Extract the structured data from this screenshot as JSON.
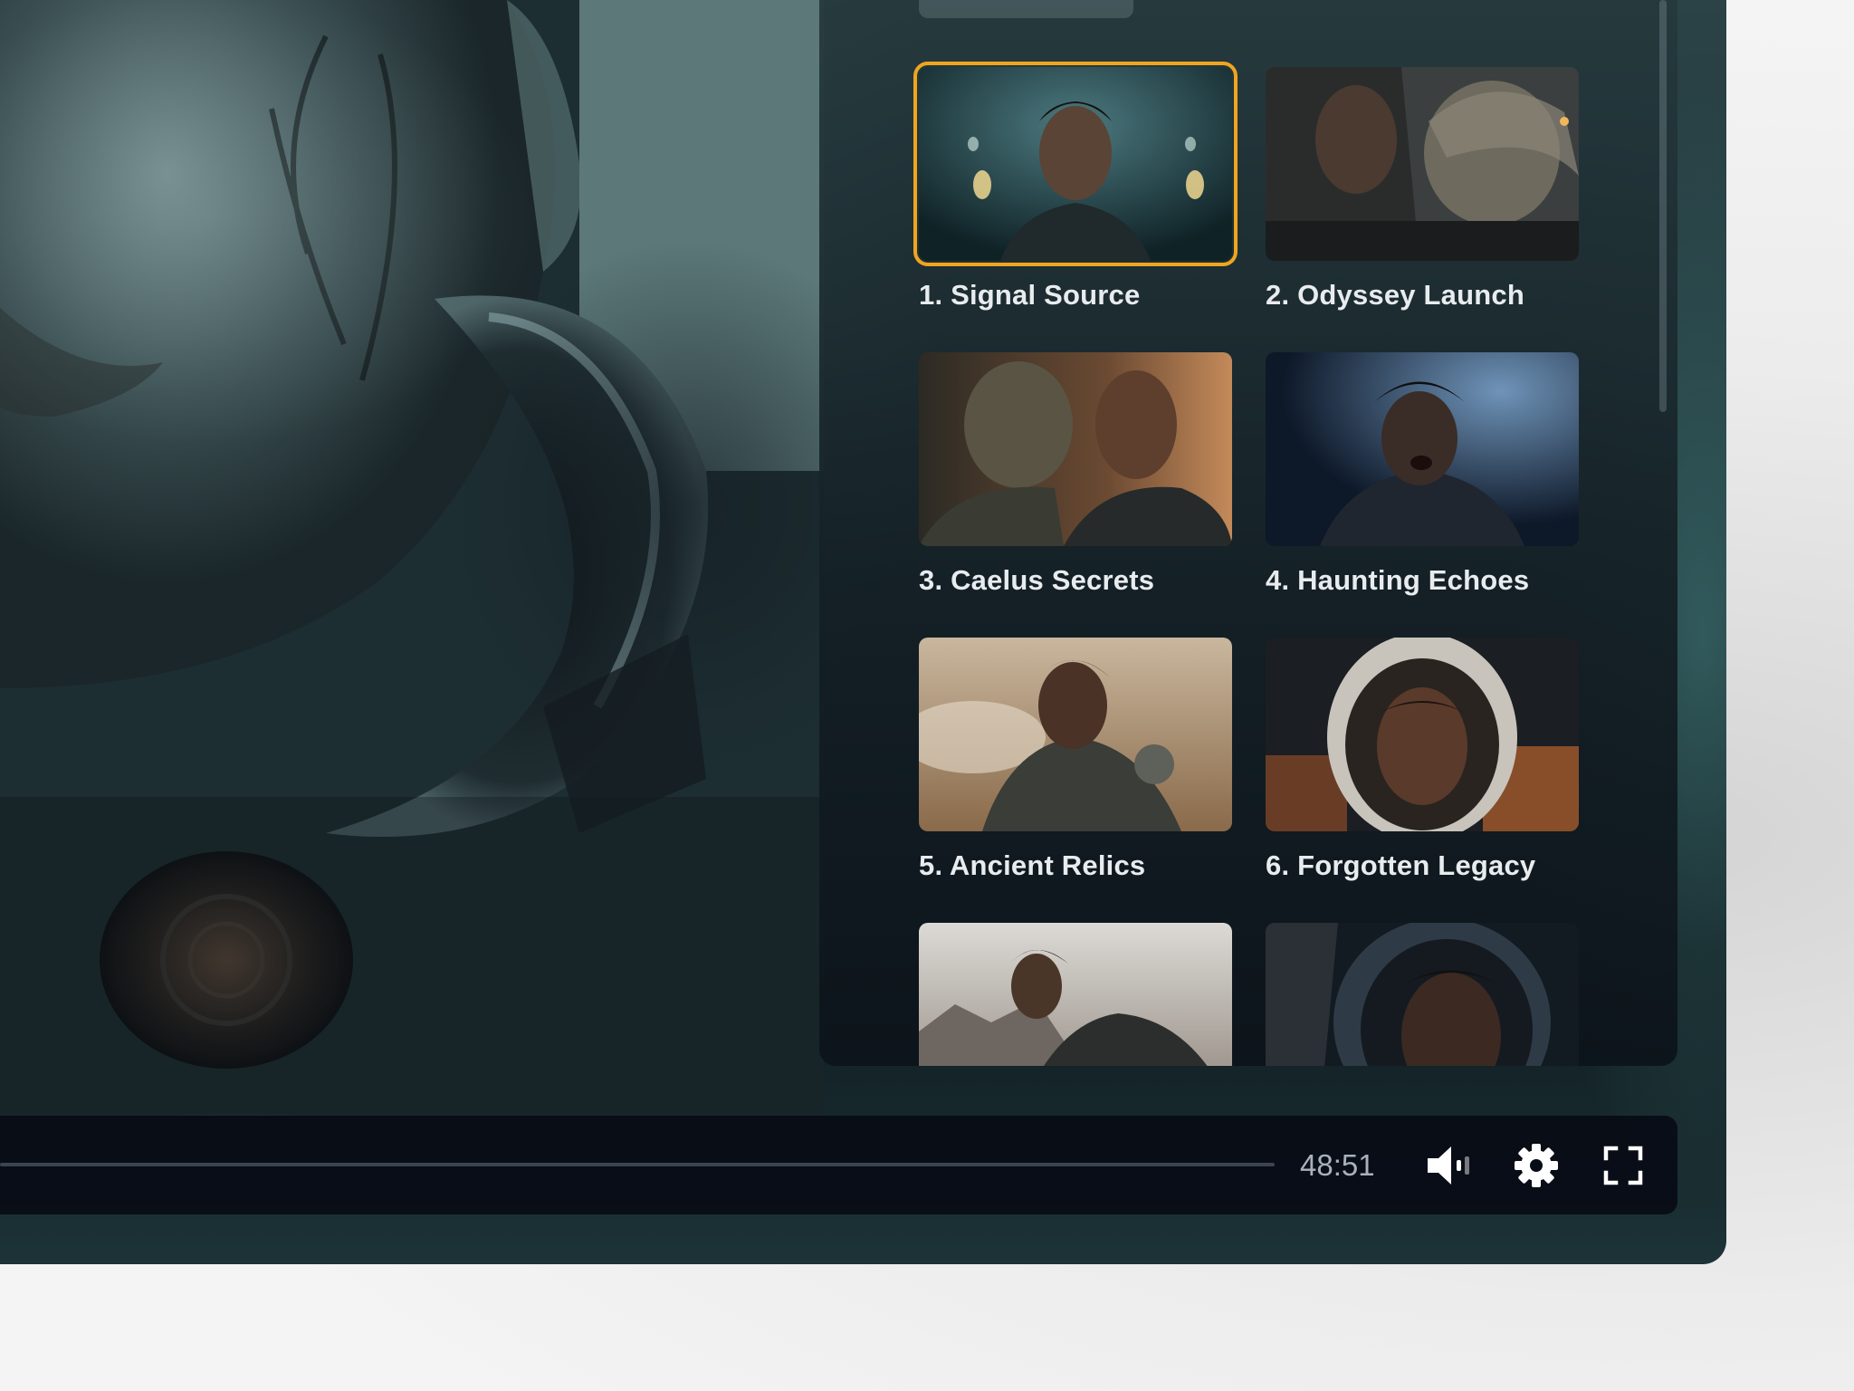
{
  "player": {
    "time_display": "48:51",
    "progress_fraction": 0
  },
  "episodes": [
    {
      "title": "1. Signal Source",
      "active": true
    },
    {
      "title": "2. Odyssey Launch",
      "active": false
    },
    {
      "title": "3. Caelus Secrets",
      "active": false
    },
    {
      "title": "4. Haunting Echoes",
      "active": false
    },
    {
      "title": "5. Ancient Relics",
      "active": false
    },
    {
      "title": "6. Forgotten Legacy",
      "active": false
    },
    {
      "title": "",
      "active": false
    },
    {
      "title": "",
      "active": false
    }
  ],
  "controls": {
    "volume_icon": "volume-icon",
    "settings_icon": "gear-icon",
    "fullscreen_icon": "fullscreen-icon"
  },
  "colors": {
    "active_outline": "#f0a520",
    "panel_bg": "#1c2c31",
    "controls_bg": "#080c16",
    "title_text": "#e8ecee",
    "time_text": "#a9b1ba"
  }
}
